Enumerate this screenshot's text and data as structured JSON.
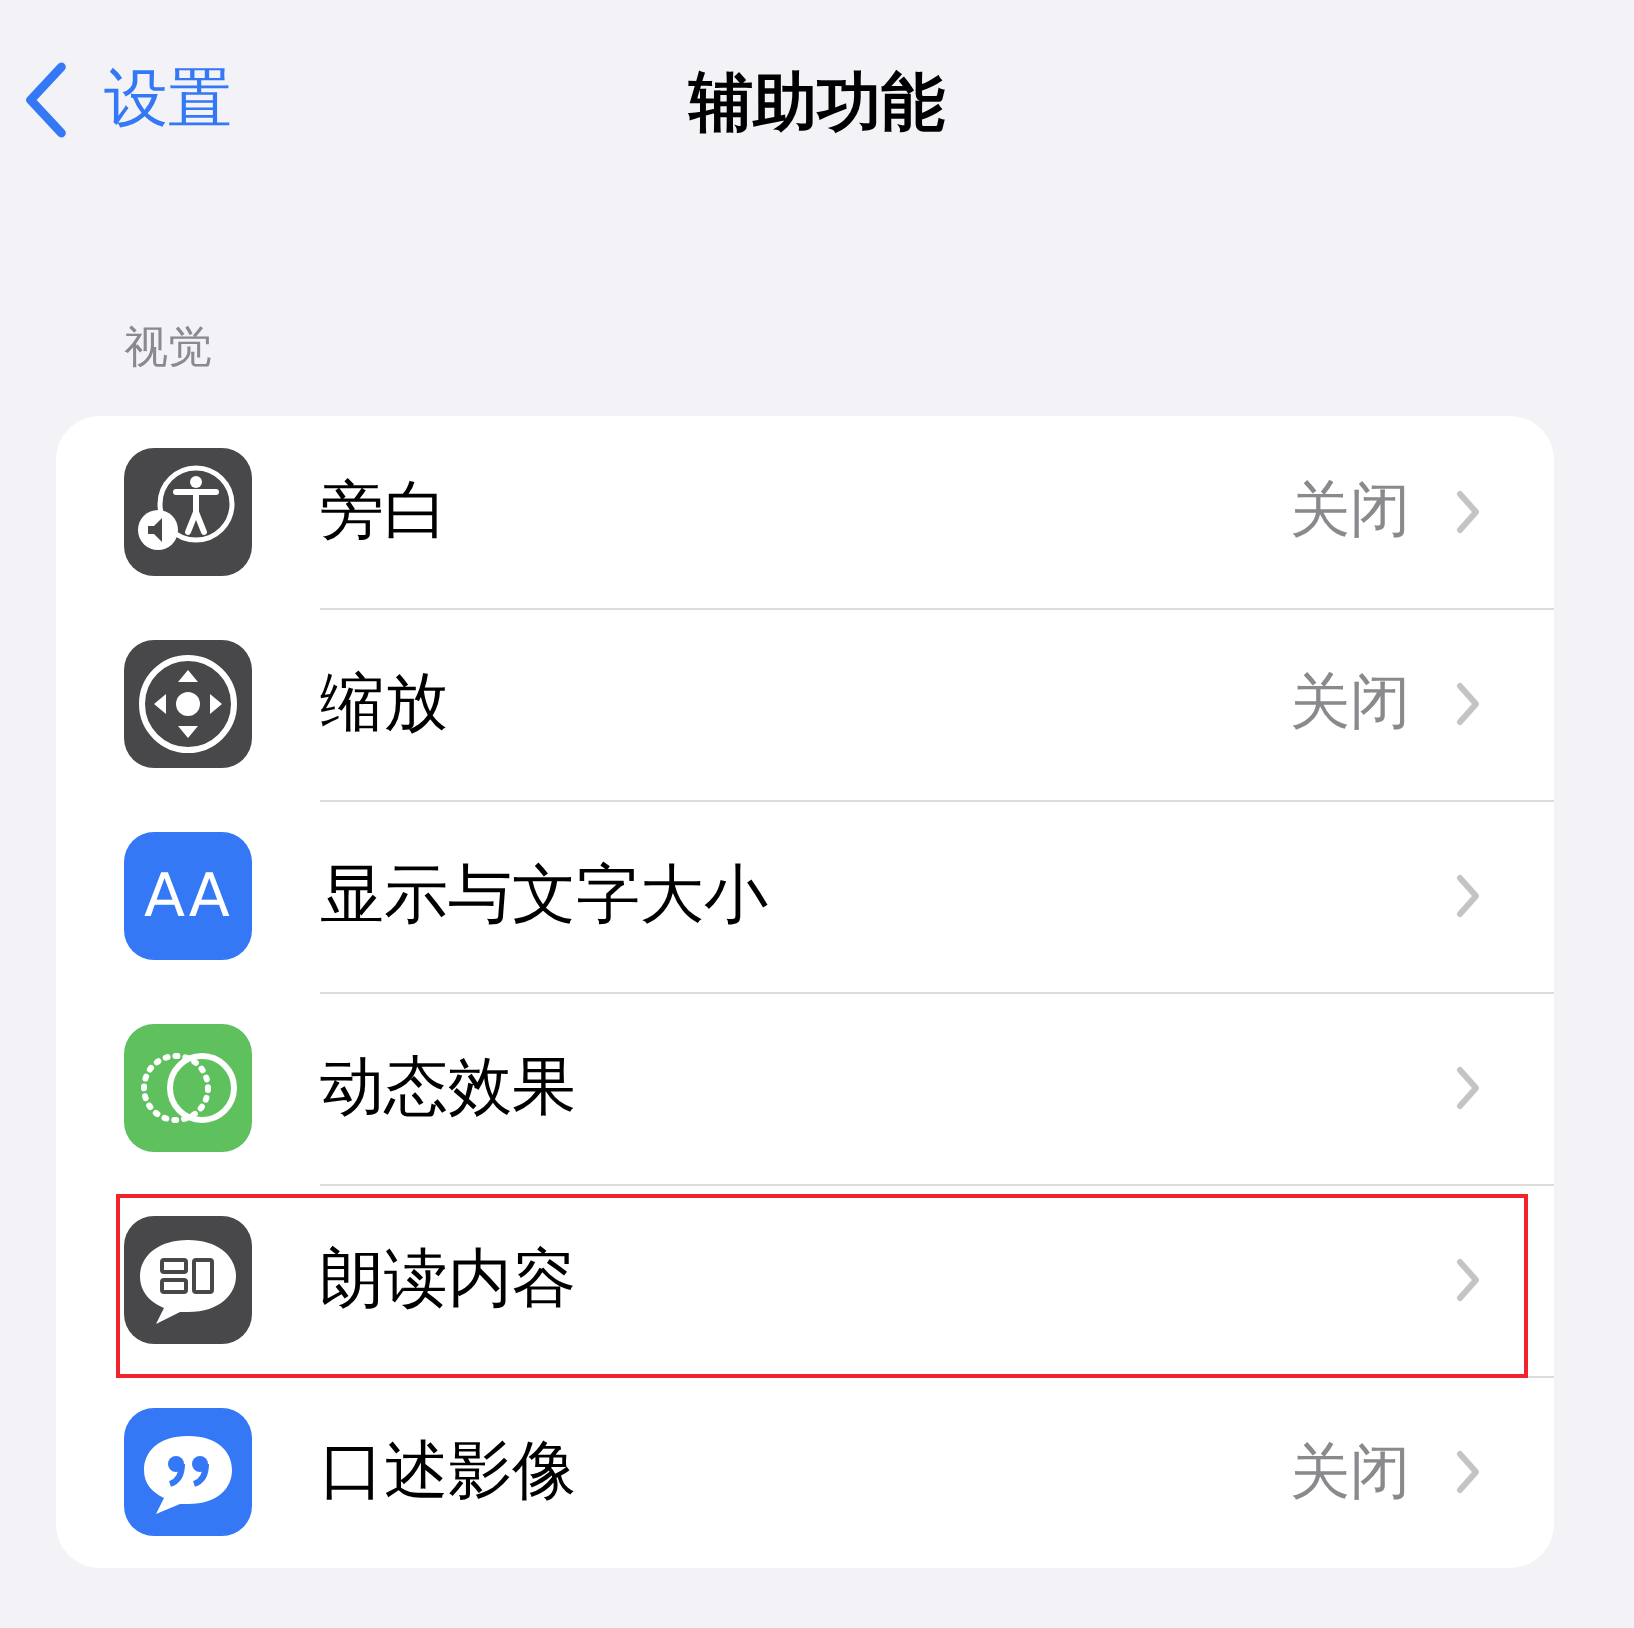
{
  "nav": {
    "back_label": "设置",
    "title": "辅助功能"
  },
  "section": {
    "header": "视觉",
    "items": [
      {
        "kind": "voiceover",
        "label": "旁白",
        "value": "关闭",
        "highlighted": false
      },
      {
        "kind": "zoom",
        "label": "缩放",
        "value": "关闭",
        "highlighted": false
      },
      {
        "kind": "text-size",
        "label": "显示与文字大小",
        "icon_text": "AA",
        "highlighted": false
      },
      {
        "kind": "motion",
        "label": "动态效果",
        "highlighted": false
      },
      {
        "kind": "spoken",
        "label": "朗读内容",
        "highlighted": true
      },
      {
        "kind": "audio-desc",
        "label": "口述影像",
        "value": "关闭",
        "highlighted": false
      }
    ]
  }
}
